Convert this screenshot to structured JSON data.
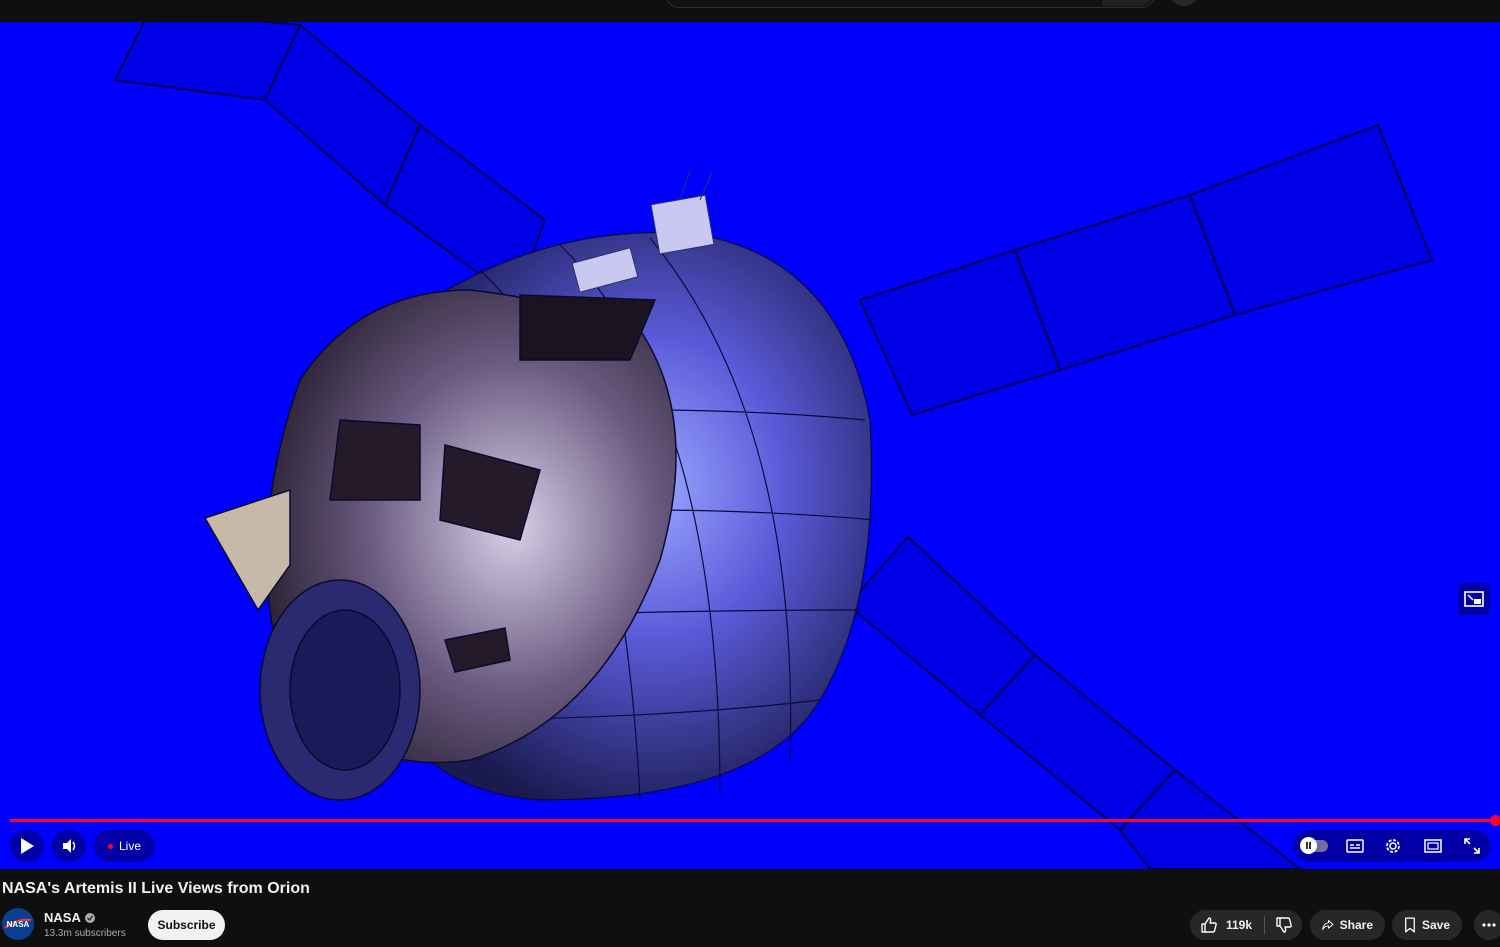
{
  "video": {
    "title": "NASA's Artemis II Live Views from Orion",
    "progress_fraction": 1.0,
    "background_color": "#0000ff"
  },
  "controls": {
    "live_label": "Live",
    "play_icon": "play-icon",
    "volume_icon": "volume-icon"
  },
  "channel": {
    "name": "NASA",
    "subscribers": "13.3m subscribers",
    "subscribe_label": "Subscribe",
    "avatar_text": "NASA"
  },
  "actions": {
    "like_count": "119k",
    "share_label": "Share",
    "save_label": "Save"
  },
  "colors": {
    "accent": "#ff0033",
    "page_bg": "#0f0f0f",
    "pill_bg": "#272727"
  }
}
